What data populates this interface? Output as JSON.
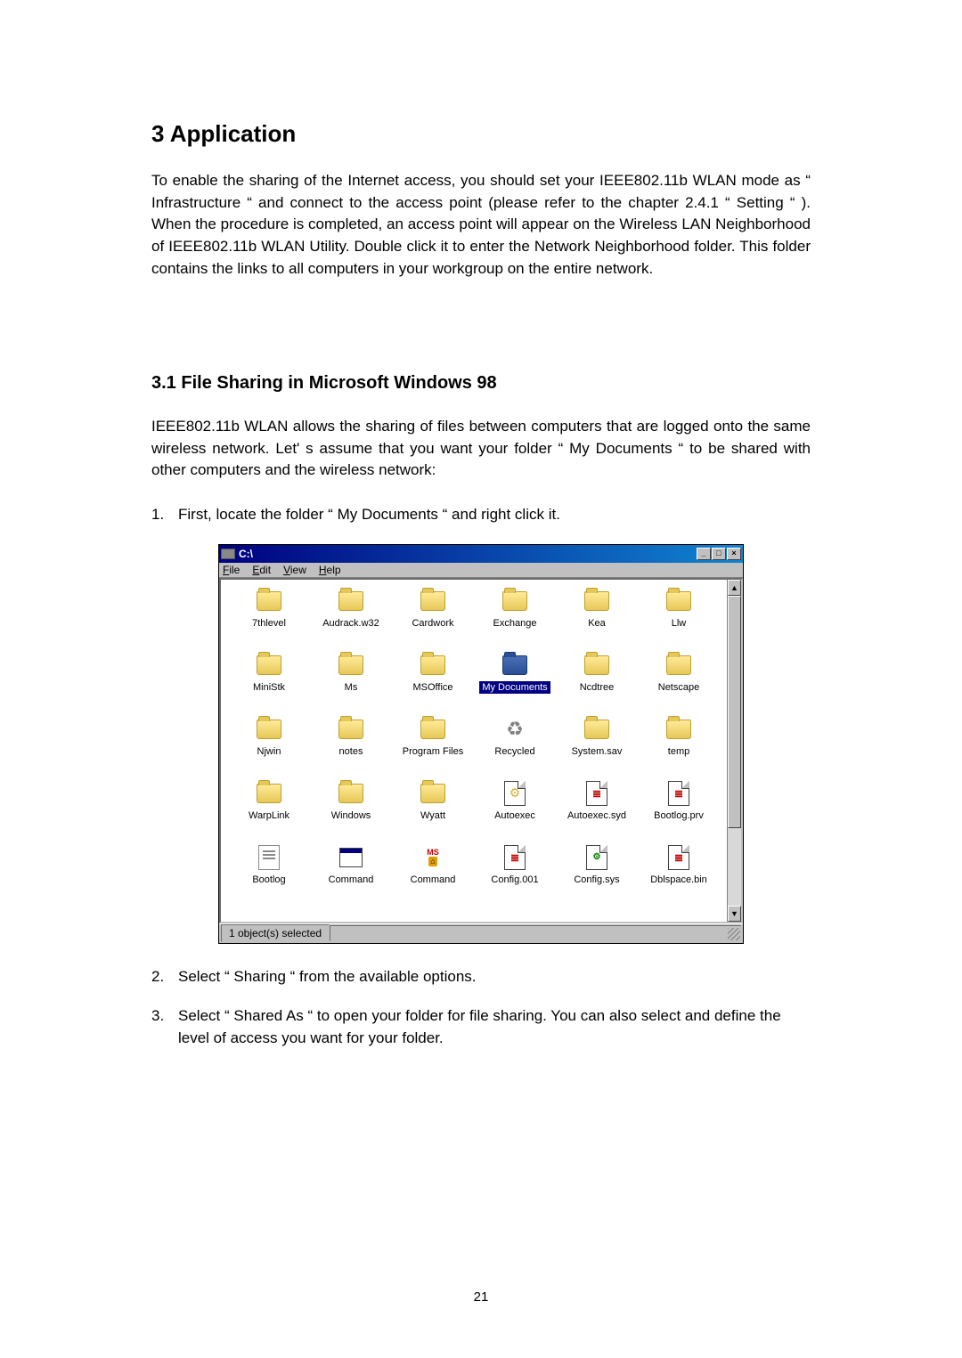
{
  "heading": "3   Application",
  "body_para": "To enable the sharing of the Internet access, you should set your IEEE802.11b WLAN mode as “ Infrastructure “ and connect to the access point (please refer to the chapter 2.4.1 “ Setting “ ). When the procedure is completed, an access point will appear on the Wireless LAN Neighborhood of IEEE802.11b WLAN Utility. Double click it to enter the Network Neighborhood folder. This folder contains the links to all computers in your workgroup on the entire network.",
  "subheading": "3.1 File Sharing in Microsoft Windows 98",
  "intro": "IEEE802.11b WLAN allows the sharing of files between computers that are logged onto the same wireless network. Let' s assume that you want your folder “ My Documents “ to be shared with other computers and the wireless network:",
  "step1_num": "1.",
  "step1_text": "First, locate the folder “ My Documents “ and right click it.",
  "step2_num": "2.",
  "step2_text": "Select “ Sharing “ from the available options.",
  "step3_num": "3.",
  "step3_text": "Select “ Shared As “ to open your folder for file sharing. You can also select and define the level of access you want for your folder.",
  "page_number": "21",
  "window": {
    "title": "C:\\",
    "minimize": "_",
    "maximize": "□",
    "close": "×",
    "menus": {
      "file": "File",
      "edit": "Edit",
      "view": "View",
      "help": "Help"
    },
    "status": "1 object(s) selected",
    "icons": {
      "r1c1": "7thlevel",
      "r1c2": "Audrack.w32",
      "r1c3": "Cardwork",
      "r1c4": "Exchange",
      "r1c5": "Kea",
      "r1c6": "Llw",
      "r2c1": "MiniStk",
      "r2c2": "Ms",
      "r2c3": "MSOffice",
      "r2c4": "My Documents",
      "r2c5": "Ncdtree",
      "r2c6": "Netscape",
      "r3c1": "Njwin",
      "r3c2": "notes",
      "r3c3": "Program Files",
      "r3c4": "Recycled",
      "r3c5": "System.sav",
      "r3c6": "temp",
      "r4c1": "WarpLink",
      "r4c2": "Windows",
      "r4c3": "Wyatt",
      "r4c4": "Autoexec",
      "r4c5": "Autoexec.syd",
      "r4c6": "Bootlog.prv",
      "r5c1": "Bootlog",
      "r5c2": "Command",
      "r5c3": "Command",
      "r5c4": "Config.001",
      "r5c5": "Config.sys",
      "r5c6": "Dblspace.bin"
    }
  }
}
